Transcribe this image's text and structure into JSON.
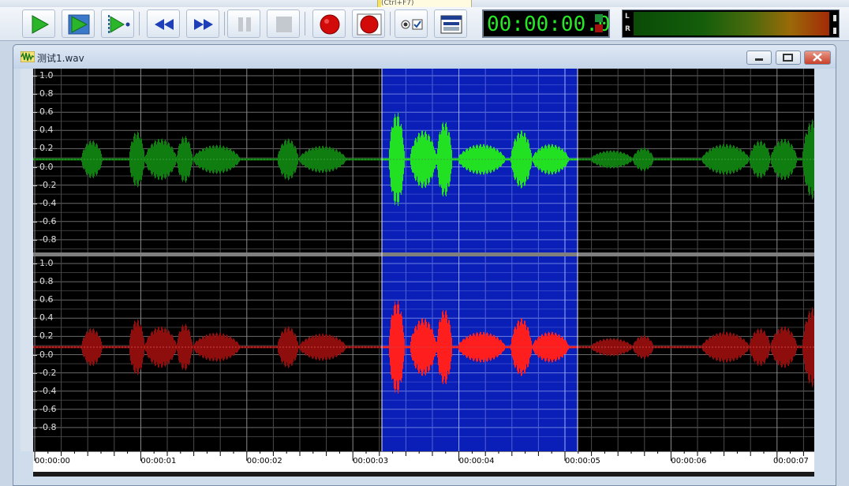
{
  "tooltip": {
    "prefix": "",
    "highlight": "",
    "text": "(Ctrl+F7)"
  },
  "toolbar": {
    "buttons": [
      {
        "name": "play-button",
        "icon": "play-icon"
      },
      {
        "name": "play-selection-button",
        "icon": "play-selection-icon"
      },
      {
        "name": "play-to-end-button",
        "icon": "play-cursor-icon"
      },
      {
        "name": "rewind-button",
        "icon": "rewind-icon"
      },
      {
        "name": "fast-forward-button",
        "icon": "fast-forward-icon"
      },
      {
        "name": "pause-button",
        "icon": "pause-icon"
      },
      {
        "name": "stop-button",
        "icon": "stop-icon"
      },
      {
        "name": "record-button",
        "icon": "record-icon"
      },
      {
        "name": "record-to-new-button",
        "icon": "record-square-icon"
      },
      {
        "name": "monitor-toggle-button",
        "icon": "monitor-checkbox-icon"
      },
      {
        "name": "view-mode-button",
        "icon": "window-icon"
      }
    ]
  },
  "timer": {
    "value": "00:00:00.0"
  },
  "level_meter": {
    "left_label": "L",
    "right_label": "R"
  },
  "document": {
    "title": "测试1.wav"
  },
  "waveform": {
    "selection": {
      "start_time": "00:00:03.3",
      "end_time": "00:00:05.0"
    },
    "y_labels": [
      "1.0",
      "0.8",
      "0.6",
      "0.4",
      "0.2",
      "0.0",
      "-0.2",
      "-0.4",
      "-0.6",
      "-0.8"
    ],
    "channels": [
      {
        "name": "left",
        "color": "#0f7d0f",
        "selected_color": "#22e022"
      },
      {
        "name": "right",
        "color": "#8e0e0e",
        "selected_color": "#ff1e1e"
      }
    ],
    "time_labels": [
      "00:00:00",
      "00:00:01",
      "00:00:02",
      "00:00:03",
      "00:00:04",
      "00:00:05",
      "00:00:06",
      "00:00:07"
    ]
  },
  "colors": {
    "selection": "#0a1fb8",
    "background": "#000000",
    "timer_text": "#27e827"
  }
}
